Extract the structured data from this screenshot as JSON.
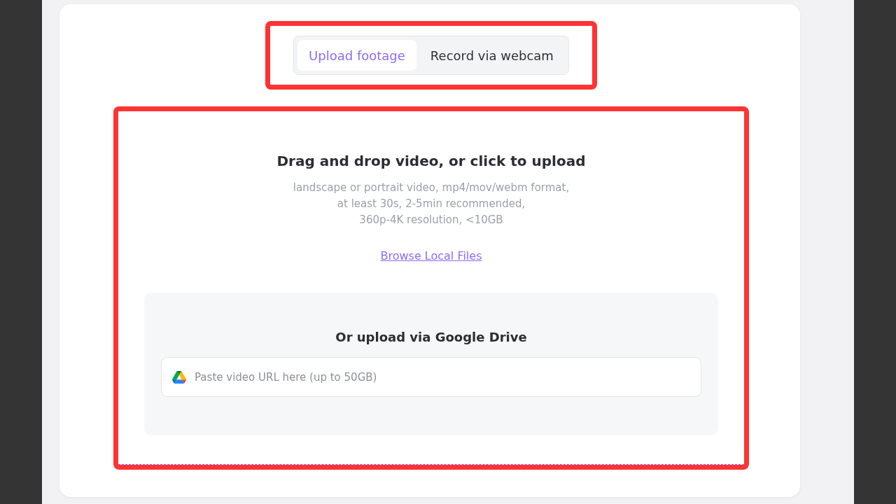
{
  "tabs": [
    {
      "label": "Upload footage",
      "selected": true
    },
    {
      "label": "Record via webcam",
      "selected": false
    }
  ],
  "drop_zone": {
    "title": "Drag and drop video, or click to upload",
    "description_lines": [
      "landscape or portrait video, mp4/mov/webm format,",
      "at least 30s, 2-5min recommended,",
      "360p-4K resolution, <10GB"
    ],
    "browse_link": "Browse Local Files"
  },
  "google_drive": {
    "title": "Or upload via Google Drive",
    "url_field": {
      "placeholder": "Paste video URL here (up to 50GB)"
    }
  }
}
